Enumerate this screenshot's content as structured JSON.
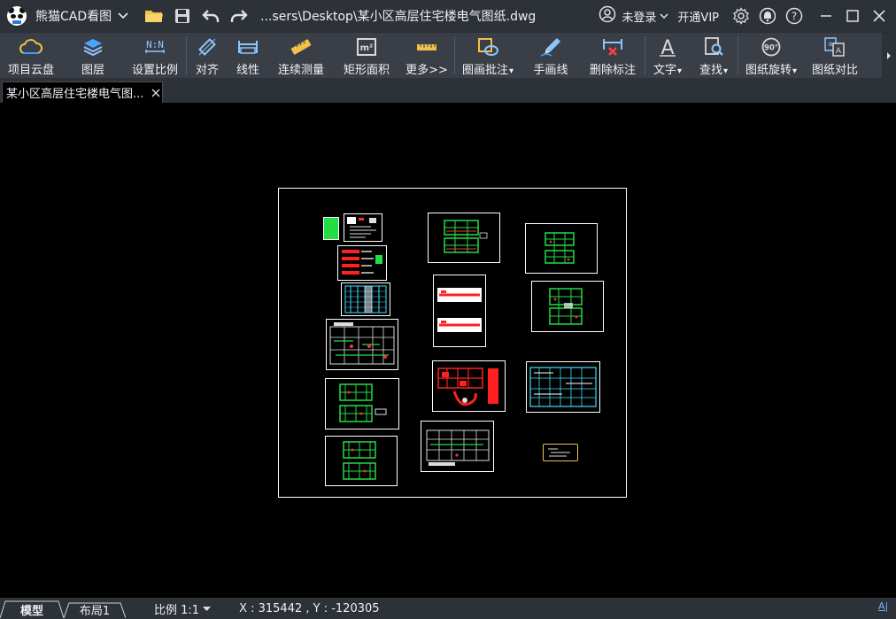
{
  "app": {
    "name": "熊猫CAD看图",
    "file_path": "...sers\\Desktop\\某小区高层住宅楼电气图纸.dwg"
  },
  "title_bar": {
    "login_label": "未登录",
    "vip_label": "开通VIP",
    "icons": [
      "open-folder-icon",
      "save-icon",
      "undo-icon",
      "redo-icon",
      "user-icon",
      "settings-icon",
      "skin-icon",
      "help-icon"
    ]
  },
  "ribbon": {
    "items": [
      {
        "label": "项目云盘",
        "icon": "cloud-drive-icon"
      },
      {
        "label": "图层",
        "icon": "layers-icon"
      },
      {
        "label": "设置比例",
        "icon": "scale-icon",
        "icon_text": "N:N"
      },
      {
        "label": "对齐",
        "icon": "align-icon"
      },
      {
        "label": "线性",
        "icon": "linear-measure-icon"
      },
      {
        "label": "连续测量",
        "icon": "continuous-measure-icon"
      },
      {
        "label": "矩形面积",
        "icon": "rect-area-icon",
        "icon_text": "m²"
      },
      {
        "label": "更多>>",
        "icon": "more-measure-icon"
      },
      {
        "label": "圈画批注",
        "icon": "markup-icon",
        "dropdown": true
      },
      {
        "label": "手画线",
        "icon": "freehand-icon"
      },
      {
        "label": "删除标注",
        "icon": "delete-dimension-icon"
      },
      {
        "label": "文字",
        "icon": "text-icon",
        "dropdown": true,
        "icon_text": "A"
      },
      {
        "label": "查找",
        "icon": "find-icon",
        "dropdown": true
      },
      {
        "label": "图纸旋转",
        "icon": "rotate-icon",
        "dropdown": true,
        "icon_text": "90°"
      },
      {
        "label": "图纸对比",
        "icon": "compare-icon"
      }
    ]
  },
  "document_tab": {
    "label": "某小区高层住宅楼电气图..."
  },
  "status_bar": {
    "tabs": [
      "模型",
      "布局1"
    ],
    "scale_label": "比例 1:1",
    "coordinates": "X : 315442 , Y : -120305"
  },
  "colors": {
    "title_bg": "#2d3138",
    "ribbon_bg": "#3a3f47",
    "canvas_bg": "#000000",
    "accent_blue": "#6fb3ff",
    "drawing_green": "#22dd44",
    "drawing_red": "#ff2020",
    "drawing_cyan": "#40e0ff"
  }
}
